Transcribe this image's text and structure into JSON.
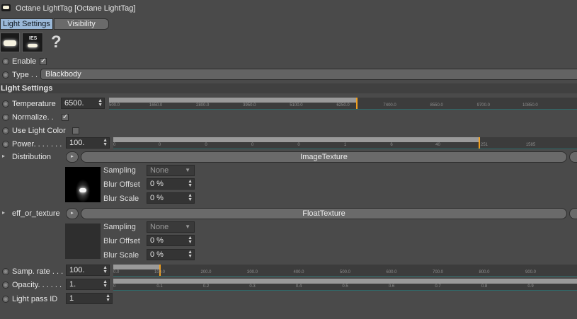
{
  "window": {
    "title": "Octane LightTag [Octane LightTag]"
  },
  "tabs": [
    {
      "label": "Light Settings",
      "active": true
    },
    {
      "label": "Visibility",
      "active": false
    }
  ],
  "help_glyph": "?",
  "icons": {
    "ies_label": "IES"
  },
  "enable": {
    "label": "Enable",
    "checked": true,
    "check_glyph": "✓"
  },
  "type": {
    "label": "Type . .",
    "value": "Blackbody"
  },
  "section_title": "Light Settings",
  "temperature": {
    "label": "Temperature",
    "value": "6500.",
    "ticks": [
      "500.0",
      "1650.0",
      "2800.0",
      "3950.0",
      "5100.0",
      "6250.0",
      "7400.0",
      "8550.0",
      "9700.0",
      "10850.0"
    ],
    "fill_fraction": 0.53
  },
  "normalize": {
    "label": "Normalize. .",
    "checked": true,
    "check_glyph": "✓"
  },
  "use_light_color": {
    "label": "Use Light Color",
    "checked": false
  },
  "power": {
    "label": "Power. . . . . . .",
    "value": "100.",
    "ticks": [
      "0",
      "0",
      "0",
      "0",
      "0",
      "1",
      "6",
      "40",
      "251",
      "1585"
    ],
    "fill_fraction": 0.79
  },
  "distribution": {
    "label": "Distribution",
    "texture": "ImageTexture",
    "sampling_label": "Sampling",
    "sampling_value": "None",
    "blur_offset_label": "Blur Offset",
    "blur_offset_value": "0 %",
    "blur_scale_label": "Blur Scale",
    "blur_scale_value": "0 %"
  },
  "eff_or_texture": {
    "label": "eff_or_texture",
    "texture": "FloatTexture",
    "sampling_label": "Sampling",
    "sampling_value": "None",
    "blur_offset_label": "Blur Offset",
    "blur_offset_value": "0 %",
    "blur_scale_label": "Blur Scale",
    "blur_scale_value": "0 %"
  },
  "samp_rate": {
    "label": "Samp. rate . . .",
    "value": "100.",
    "ticks": [
      "0.0",
      "100.0",
      "200.0",
      "300.0",
      "400.0",
      "500.0",
      "600.0",
      "700.0",
      "800.0",
      "900.0"
    ],
    "fill_fraction": 0.1
  },
  "opacity": {
    "label": "Opacity. . . . . .",
    "value": "1.",
    "ticks": [
      "0",
      "0.1",
      "0.2",
      "0.3",
      "0.4",
      "0.5",
      "0.6",
      "0.7",
      "0.8",
      "0.9"
    ],
    "fill_fraction": 1.0
  },
  "light_pass_id": {
    "label": "Light pass ID",
    "value": "1"
  },
  "colors": {
    "background": "#4a4a4a",
    "accent_tab": "#9ab8d8",
    "slider_marker": "#f0a020",
    "slider_baseline": "#2f6a6a"
  }
}
